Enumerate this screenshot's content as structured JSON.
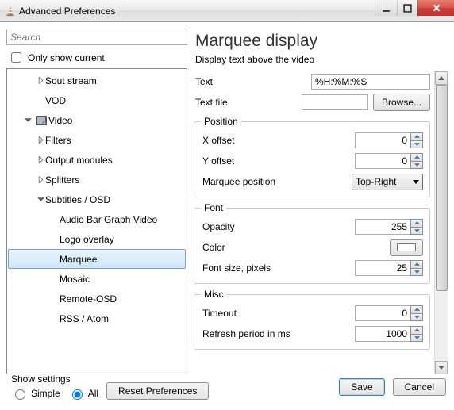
{
  "window": {
    "title": "Advanced Preferences"
  },
  "search": {
    "placeholder": "Search"
  },
  "only_show_current_label": "Only show current",
  "tree": {
    "sout_stream": "Sout stream",
    "vod": "VOD",
    "video": "Video",
    "filters": "Filters",
    "output_modules": "Output modules",
    "splitters": "Splitters",
    "subtitles_osd": "Subtitles / OSD",
    "audio_bar_graph": "Audio Bar Graph Video",
    "logo_overlay": "Logo overlay",
    "marquee": "Marquee",
    "mosaic": "Mosaic",
    "remote_osd": "Remote-OSD",
    "rss_atom": "RSS / Atom"
  },
  "panel": {
    "heading": "Marquee display",
    "subtitle": "Display text above the video",
    "text_label": "Text",
    "text_value": "%H:%M:%S",
    "textfile_label": "Text file",
    "textfile_value": "",
    "browse": "Browse...",
    "group_position": "Position",
    "xoffset_label": "X offset",
    "xoffset_value": "0",
    "yoffset_label": "Y offset",
    "yoffset_value": "0",
    "marquee_pos_label": "Marquee position",
    "marquee_pos_value": "Top-Right",
    "group_font": "Font",
    "opacity_label": "Opacity",
    "opacity_value": "255",
    "color_label": "Color",
    "color_value": "#FFFFFF",
    "fontsize_label": "Font size, pixels",
    "fontsize_value": "25",
    "group_misc": "Misc",
    "timeout_label": "Timeout",
    "timeout_value": "0",
    "refresh_label": "Refresh period in ms",
    "refresh_value": "1000"
  },
  "bottom": {
    "show_settings": "Show settings",
    "simple": "Simple",
    "all": "All",
    "reset": "Reset Preferences",
    "save": "Save",
    "cancel": "Cancel"
  }
}
